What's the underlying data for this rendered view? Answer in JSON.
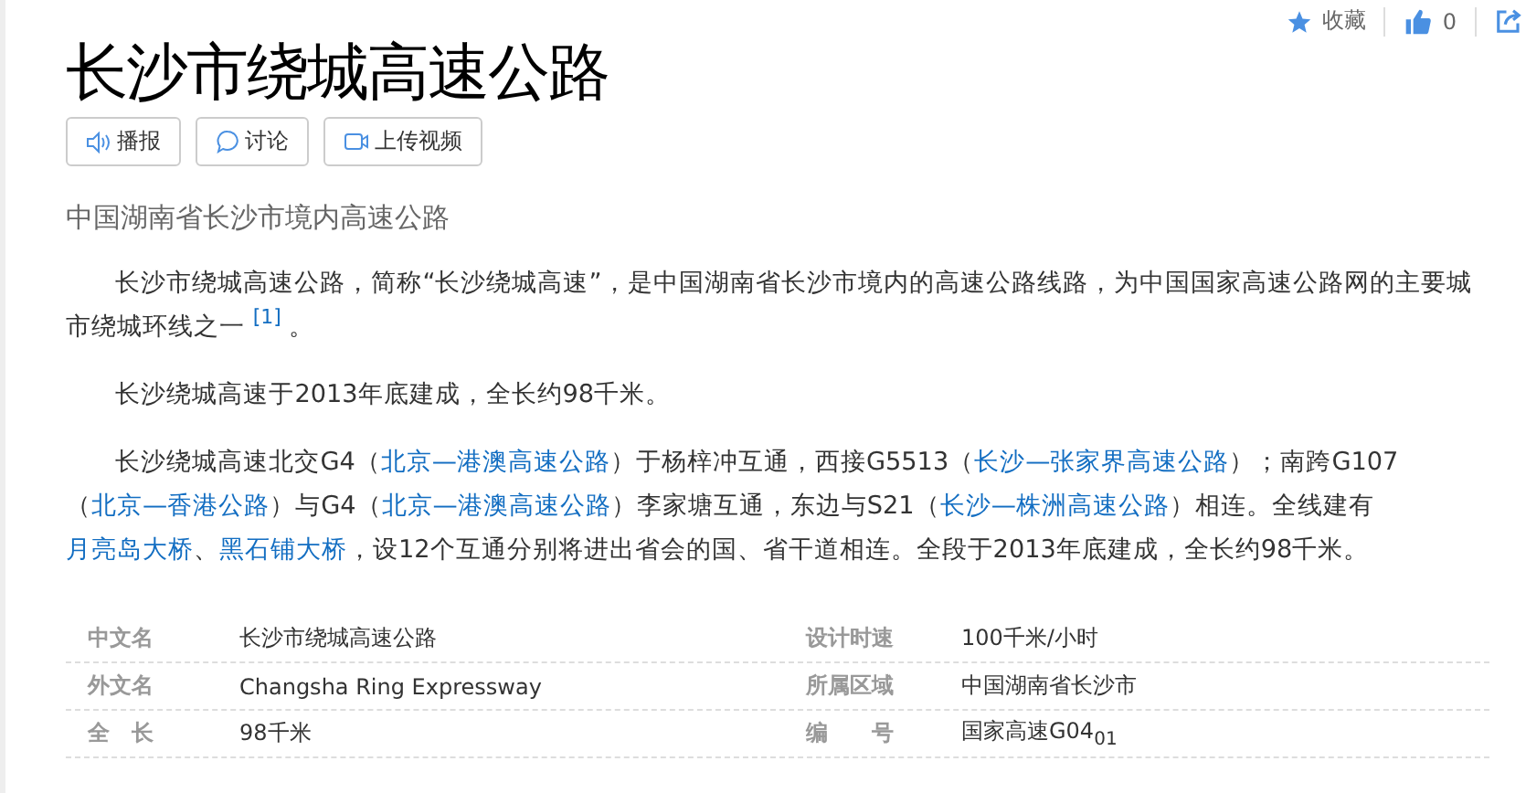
{
  "toolbar": {
    "favorite": "收藏",
    "like_count": "0"
  },
  "title": "长沙市绕城高速公路",
  "actions": [
    {
      "kind": "audio",
      "label": "播报"
    },
    {
      "kind": "comment",
      "label": "讨论"
    },
    {
      "kind": "video",
      "label": "上传视频"
    }
  ],
  "subtitle": "中国湖南省长沙市境内高速公路",
  "paragraphs": [
    [
      {
        "kind": "text",
        "text": "长沙市绕城高速公路，简称“长沙绕城高速”，是中国湖南省长沙市境内的高速公路线路，为中国国家高速公路网的主要城市绕城环线之一 "
      },
      {
        "kind": "ref",
        "text": "[1]"
      },
      {
        "kind": "text",
        "text": " 。"
      }
    ],
    [
      {
        "kind": "text",
        "text": "长沙绕城高速于2013年底建成，全长约98千米。"
      }
    ],
    [
      {
        "kind": "text",
        "text": "长沙绕城高速北交G4（"
      },
      {
        "kind": "link",
        "text": "北京—港澳高速公路"
      },
      {
        "kind": "text",
        "text": "）于杨梓冲互通，西接G5513（"
      },
      {
        "kind": "link",
        "text": "长沙—张家界高速公路"
      },
      {
        "kind": "text",
        "text": "）；南跨G107（"
      },
      {
        "kind": "link",
        "text": "北京—香港公路"
      },
      {
        "kind": "text",
        "text": "）与G4（"
      },
      {
        "kind": "link",
        "text": "北京—港澳高速公路"
      },
      {
        "kind": "text",
        "text": "）李家塘互通，东边与S21（"
      },
      {
        "kind": "link",
        "text": "长沙—株洲高速公路"
      },
      {
        "kind": "text",
        "text": "）相连。全线建有"
      },
      {
        "kind": "link",
        "text": "月亮岛大桥"
      },
      {
        "kind": "text",
        "text": "、"
      },
      {
        "kind": "link",
        "text": "黑石铺大桥"
      },
      {
        "kind": "text",
        "text": "，设12个互通分别将进出省会的国、省干道相连。全段于2013年底建成，全长约98千米。"
      }
    ]
  ],
  "infobox": [
    [
      {
        "label": "中文名",
        "value": "长沙市绕城高速公路"
      },
      {
        "label": "设计时速",
        "value": "100千米/小时"
      }
    ],
    [
      {
        "label": "外文名",
        "value": "Changsha Ring Expressway"
      },
      {
        "label": "所属区域",
        "value": "中国湖南省长沙市"
      }
    ],
    [
      {
        "label": "全　长",
        "value": "98千米"
      },
      {
        "label": "编　　号",
        "value": "国家高速G04$_{01}$"
      }
    ]
  ]
}
